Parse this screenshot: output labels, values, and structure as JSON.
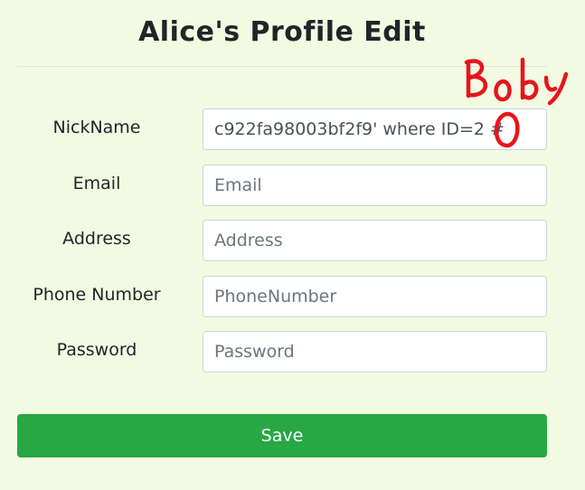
{
  "page": {
    "title": "Alice's Profile Edit"
  },
  "form": {
    "nickname": {
      "label": "NickName",
      "value": "c922fa98003bf2f9' where ID=2 #"
    },
    "email": {
      "label": "Email",
      "placeholder": "Email"
    },
    "address": {
      "label": "Address",
      "placeholder": "Address"
    },
    "phone": {
      "label": "Phone Number",
      "placeholder": "PhoneNumber"
    },
    "password": {
      "label": "Password",
      "placeholder": "Password"
    },
    "save_label": "Save"
  },
  "annotation": {
    "text": "Boby",
    "color": "#e8141c"
  },
  "colors": {
    "background": "#f2fbe2",
    "save_button": "#28a745"
  }
}
